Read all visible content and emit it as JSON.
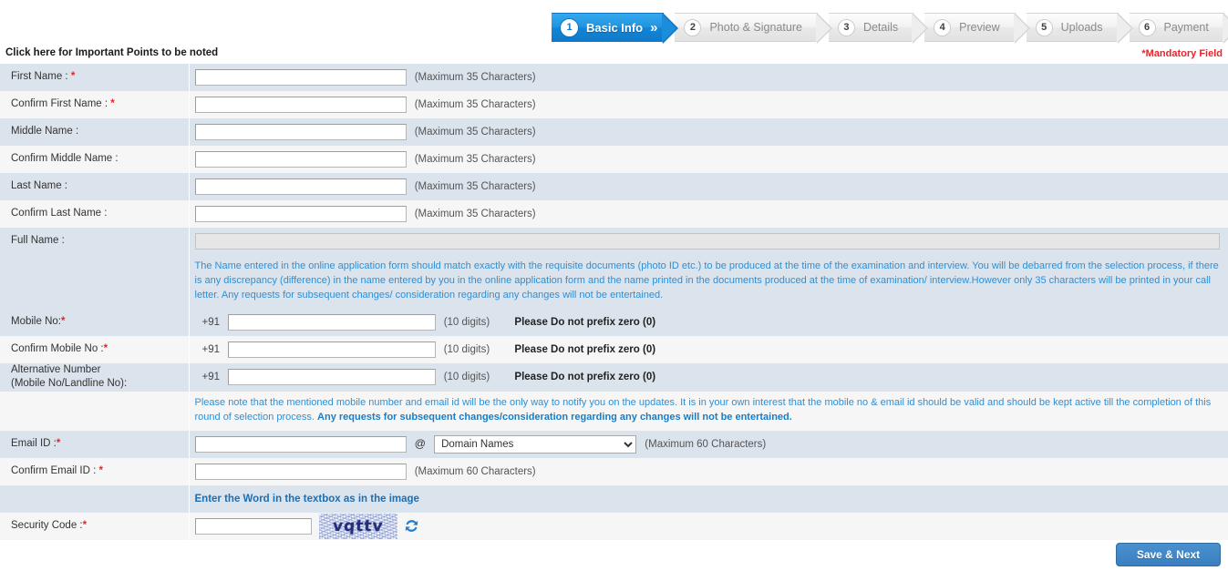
{
  "wizard": {
    "steps": [
      {
        "num": "1",
        "label": "Basic Info",
        "active": true,
        "chevron": "»"
      },
      {
        "num": "2",
        "label": "Photo & Signature",
        "active": false
      },
      {
        "num": "3",
        "label": "Details",
        "active": false
      },
      {
        "num": "4",
        "label": "Preview",
        "active": false
      },
      {
        "num": "5",
        "label": "Uploads",
        "active": false
      },
      {
        "num": "6",
        "label": "Payment",
        "active": false
      }
    ]
  },
  "header": {
    "important_link": "Click here for Important Points to be noted",
    "mandatory_note": "*Mandatory Field"
  },
  "form": {
    "first_name": {
      "label": "First Name : ",
      "required": "*",
      "value": "",
      "hint": "(Maximum 35 Characters)"
    },
    "confirm_first_name": {
      "label": "Confirm First Name : ",
      "required": "*",
      "value": "",
      "hint": "(Maximum 35 Characters)"
    },
    "middle_name": {
      "label": "Middle Name :",
      "value": "",
      "hint": "(Maximum 35 Characters)"
    },
    "confirm_middle_name": {
      "label": "Confirm Middle Name :",
      "value": "",
      "hint": "(Maximum 35 Characters)"
    },
    "last_name": {
      "label": "Last Name :",
      "value": "",
      "hint": "(Maximum 35 Characters)"
    },
    "confirm_last_name": {
      "label": "Confirm Last Name :",
      "value": "",
      "hint": "(Maximum 35 Characters)"
    },
    "full_name": {
      "label": "Full Name :",
      "value": ""
    },
    "name_note": "The Name entered in the online application form should match exactly with the requisite documents (photo ID etc.) to be produced at the time of the examination and interview. You will be debarred from the selection process, if there is any discrepancy (difference) in the name entered by you in the online application form and the name printed in the documents produced at the time of examination/ interview.However only 35 characters will be printed in your call letter. Any requests for subsequent changes/ consideration regarding any changes will not be entertained.",
    "mobile": {
      "label": "Mobile No:",
      "required": "*",
      "country_code": "+91",
      "value": "",
      "hint": "(10 digits)",
      "warning": "Please Do not prefix zero (0)"
    },
    "confirm_mobile": {
      "label": "Confirm Mobile No :",
      "required": "*",
      "country_code": "+91",
      "value": "",
      "hint": "(10 digits)",
      "warning": "Please Do not prefix zero (0)"
    },
    "alternative_number": {
      "label_line1": "Alternative Number",
      "label_line2": "(Mobile No/Landline No):",
      "country_code": "+91",
      "value": "",
      "hint": "(10 digits)",
      "warning": "Please Do not prefix zero (0)"
    },
    "contact_note_part1": "Please note that the mentioned mobile number and email id will be the only way to notify you on the updates. It is in your own interest that the mobile no & email id should be valid and should be kept active till the completion of this round of selection process. ",
    "contact_note_part2": "Any requests for subsequent changes/consideration regarding any changes will not be entertained.",
    "email": {
      "label": "Email ID :",
      "required": "*",
      "value": "",
      "at_symbol": "@",
      "domain_selected": "Domain Names",
      "domain_options": [
        "Domain Names"
      ],
      "hint": "(Maximum 60 Characters)"
    },
    "confirm_email": {
      "label": "Confirm Email ID : ",
      "required": "*",
      "value": "",
      "hint": "(Maximum 60 Characters)"
    },
    "captcha_instruction": "Enter the Word in the textbox as in the image",
    "security_code": {
      "label": "Security Code :",
      "required": "*",
      "value": "",
      "image_text": "vqttv",
      "refresh_icon": "refresh-icon"
    }
  },
  "footer": {
    "save_next": "Save & Next"
  },
  "colors": {
    "accent_blue": "#1079c9",
    "row_blue": "#dbe3ec",
    "row_gray": "#f6f6f6",
    "note_blue": "#2f8fd4",
    "required_red": "#e8232a",
    "button_blue": "#3a7fc0"
  }
}
